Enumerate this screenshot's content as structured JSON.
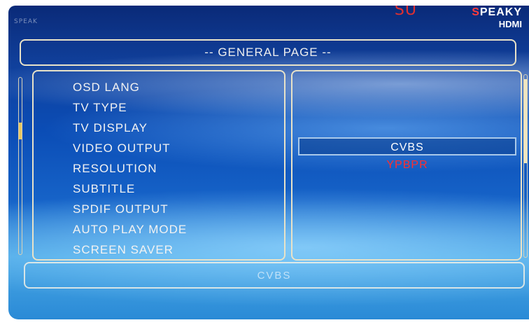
{
  "brand": {
    "prefix": "SU",
    "name_first": "S",
    "name_rest": "PEAKY",
    "sub": "HDMI"
  },
  "corner_text": "SPEAK",
  "header": {
    "title": "-- GENERAL PAGE --"
  },
  "menu": {
    "items": [
      {
        "label": "OSD LANG"
      },
      {
        "label": "TV TYPE"
      },
      {
        "label": "TV DISPLAY"
      },
      {
        "label": "VIDEO OUTPUT"
      },
      {
        "label": "RESOLUTION"
      },
      {
        "label": "SUBTITLE"
      },
      {
        "label": "SPDIF OUTPUT"
      },
      {
        "label": "AUTO PLAY MODE"
      },
      {
        "label": "SCREEN SAVER"
      }
    ]
  },
  "options": {
    "selected": "CVBS",
    "highlighted": "YPBPR",
    "highlight_color": "#ff2e2e"
  },
  "status": {
    "text": "CVBS"
  },
  "colors": {
    "border": "#e8e2c8",
    "background": "#0b4db6"
  }
}
